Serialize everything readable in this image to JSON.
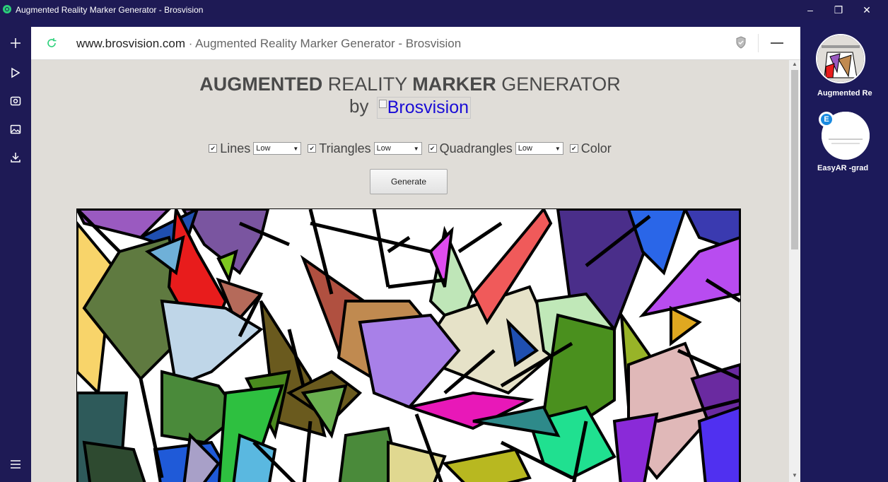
{
  "window": {
    "title": "Augmented Reality Marker Generator - Brosvision",
    "minimize": "–",
    "restore": "❐",
    "close": "✕"
  },
  "sidebar": {
    "icons": [
      "plus-icon",
      "play-icon",
      "camera-icon",
      "image-icon",
      "download-icon",
      "menu-icon"
    ]
  },
  "address": {
    "domain": "www.brosvision.com",
    "separator": " · ",
    "page_title": "Augmented Reality Marker Generator - Brosvision"
  },
  "page": {
    "heading_part1": "AUGMENTED",
    "heading_part2": " REALITY ",
    "heading_part3": "MARKER",
    "heading_part4": " GENERATOR",
    "by": "by",
    "logo_alt": "Brosvision",
    "options": [
      {
        "label": "Lines",
        "checked": true,
        "value": "Low"
      },
      {
        "label": "Triangles",
        "checked": true,
        "value": "Low"
      },
      {
        "label": "Quadrangles",
        "checked": true,
        "value": "Low"
      },
      {
        "label": "Color",
        "checked": true
      }
    ],
    "generate_label": "Generate"
  },
  "tabs": [
    {
      "label": "Augmented Re"
    },
    {
      "label": "EasyAR -grad"
    }
  ],
  "colors": {
    "frame": "#1e1a55",
    "page_bg": "#e0ddd8",
    "logo_link": "#1a0dd6"
  }
}
